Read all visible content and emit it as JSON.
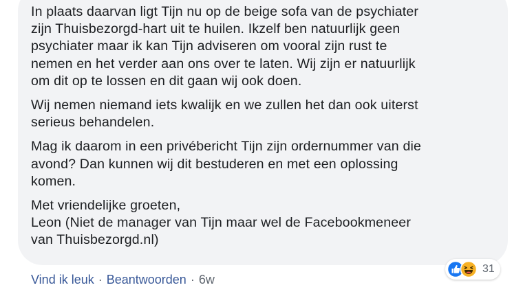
{
  "comment": {
    "paragraphs": [
      "In plaats daarvan ligt Tijn nu op de beige sofa van de psychiater\nzijn Thuisbezorgd-hart uit te huilen. Ikzelf ben natuurlijk geen\npsychiater maar ik kan Tijn adviseren om vooral zijn rust te\nnemen en het verder aan ons over te laten. Wij zijn er natuurlijk\nom dit op te lossen en dit gaan wij ook doen.",
      "Wij nemen niemand iets kwalijk en we zullen het dan ook uiterst\nserieus behandelen.",
      "Mag ik daarom in een privébericht Tijn zijn ordernummer van die\navond? Dan kunnen wij dit bestuderen en met een oplossing\nkomen.",
      "Met vriendelijke groeten,\nLeon (Niet de manager van Tijn maar wel de Facebookmeneer\nvan Thuisbezorgd.nl)"
    ]
  },
  "reactions": {
    "icons": [
      "like-icon",
      "haha-icon"
    ],
    "count": "31",
    "colors": {
      "like": "#1877f2",
      "haha": "#f7b125"
    }
  },
  "actions": {
    "like_label": "Vind ik leuk",
    "reply_label": "Beantwoorden",
    "separator": "·",
    "timestamp": "6w"
  },
  "colors": {
    "bubble": "#f2f3f5",
    "text": "#1c1e21",
    "link": "#385898",
    "muted": "#606770"
  }
}
